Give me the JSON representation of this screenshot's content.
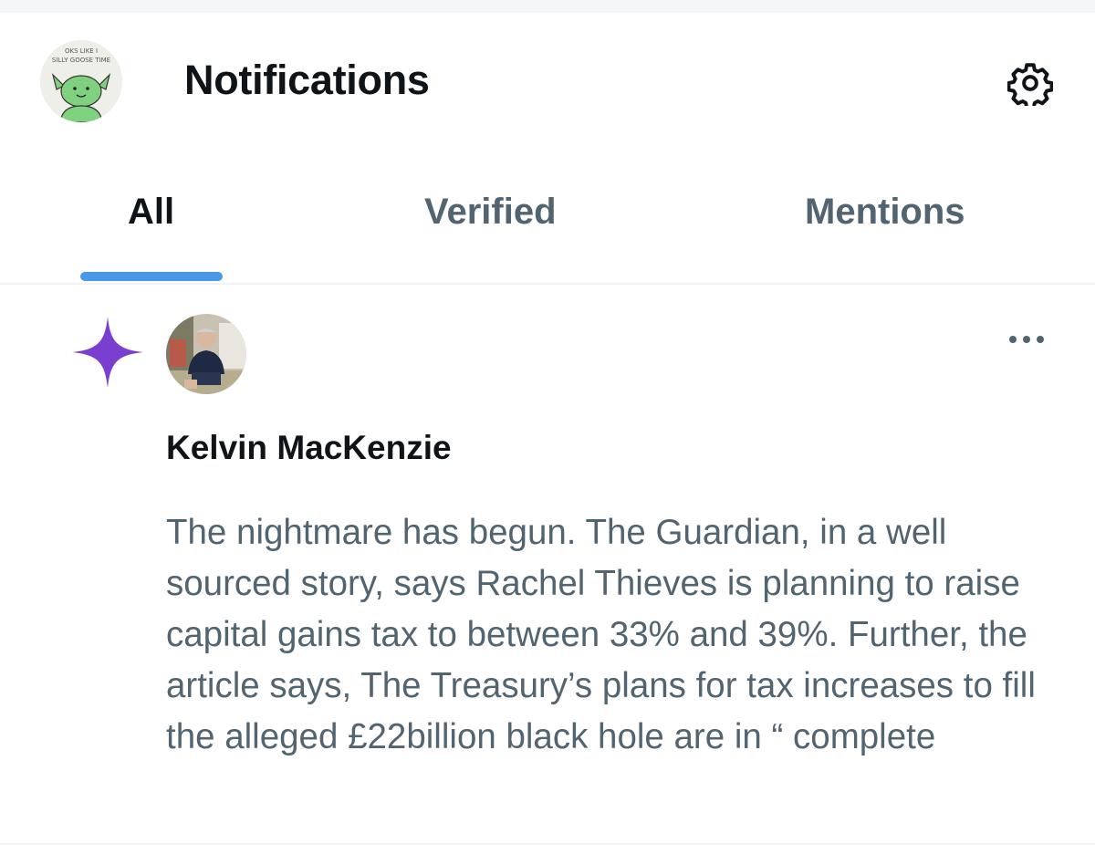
{
  "header": {
    "title": "Notifications",
    "avatar_icon": "silly-goose-avatar",
    "avatar_caption_line1": "OKS LIKE I",
    "avatar_caption_line2": "SILLY GOOSE TIME",
    "settings_icon": "gear-icon"
  },
  "tabs": [
    {
      "label": "All",
      "active": true
    },
    {
      "label": "Verified",
      "active": false
    },
    {
      "label": "Mentions",
      "active": false
    }
  ],
  "notification": {
    "type_icon": "sparkle-icon",
    "author_name": "Kelvin MacKenzie",
    "text": "The nightmare has begun. The Guardian, in a well sourced story, says Rachel Thieves is planning to raise capital gains tax to between 33% and 39%. Further, the article says, The Treasury’s plans for tax increases to fill the alleged £22billion black hole are in “ complete",
    "more_icon": "more-options-icon"
  },
  "colors": {
    "tab_indicator": "#4a99e9",
    "sparkle": "#7b3fd0",
    "text_primary": "#0f1419",
    "text_secondary": "#536471"
  }
}
